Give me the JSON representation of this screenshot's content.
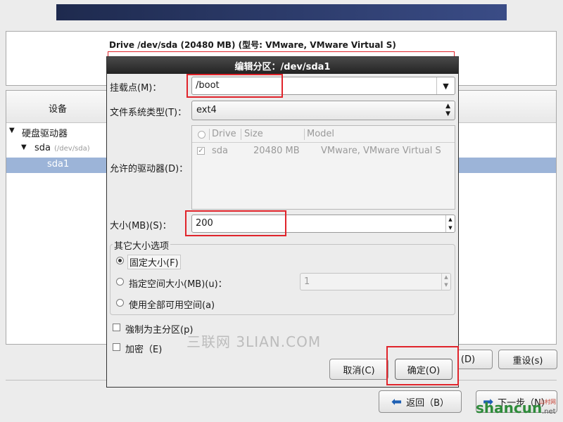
{
  "background": {
    "drive_info": "Drive /dev/sda (20480 MB) (型号: VMware, VMware Virtual S)",
    "device_header": "设备",
    "tree": {
      "root": "硬盘驱动器",
      "disk": "sda",
      "disk_path": "(/dev/sda)",
      "partition": "sda1"
    },
    "delete_button": "(D)",
    "reset_button": "重设(s)",
    "back_button": "返回（B）",
    "next_button": "下一步（N）"
  },
  "dialog": {
    "title": "编辑分区：/dev/sda1",
    "mount_point_label": "挂载点(M)：",
    "mount_point_value": "/boot",
    "fs_type_label": "文件系统类型(T)：",
    "fs_type_value": "ext4",
    "drives_label": "允许的驱动器(D)：",
    "drives_table": {
      "columns": [
        "Drive",
        "Size",
        "Model"
      ],
      "rows": [
        {
          "checked": true,
          "drive": "sda",
          "size": "20480 MB",
          "model": "VMware, VMware Virtual S"
        }
      ]
    },
    "size_label": "大小(MB)(S)：",
    "size_value": "200",
    "other_size_group": "其它大小选项",
    "fixed_size": "固定大小(F)",
    "fill_to_size": "指定空间大小(MB)(u)：",
    "fill_to_size_value": "1",
    "fill_all": "使用全部可用空间(a)",
    "force_primary": "強制为主分区(p)",
    "encrypt": "加密（E)",
    "cancel_button": "取消(C)",
    "ok_button": "确定(O)"
  },
  "watermarks": {
    "center": "三联网 3LIAN.COM",
    "corner": "shancun",
    "corner_suffix": ".net",
    "corner_tag": "山村网"
  },
  "colors": {
    "highlight": "#9cb4d8",
    "red_annotation": "#e0242b",
    "banner": "#2a3a6e"
  }
}
